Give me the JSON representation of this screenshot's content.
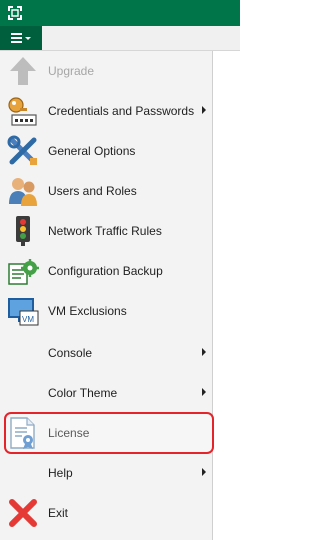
{
  "colors": {
    "titlebar": "#00754a",
    "menu_button": "#005f3d",
    "highlight": "#e4242a"
  },
  "menu": {
    "button_icon": "hamburger-menu-icon",
    "items": [
      {
        "label": "Upgrade",
        "icon": "upgrade-arrow-icon",
        "disabled": true,
        "submenu": false
      },
      {
        "label": "Credentials and Passwords",
        "icon": "key-icon",
        "disabled": false,
        "submenu": true
      },
      {
        "label": "General Options",
        "icon": "tools-icon",
        "disabled": false,
        "submenu": false
      },
      {
        "label": "Users and Roles",
        "icon": "users-icon",
        "disabled": false,
        "submenu": false
      },
      {
        "label": "Network Traffic Rules",
        "icon": "traffic-light-icon",
        "disabled": false,
        "submenu": false
      },
      {
        "label": "Configuration Backup",
        "icon": "config-backup-icon",
        "disabled": false,
        "submenu": false
      },
      {
        "label": "VM Exclusions",
        "icon": "vm-icon",
        "disabled": false,
        "submenu": false
      },
      {
        "label": "Console",
        "icon": "",
        "disabled": false,
        "submenu": true
      },
      {
        "label": "Color Theme",
        "icon": "",
        "disabled": false,
        "submenu": true
      },
      {
        "label": "License",
        "icon": "license-document-icon",
        "disabled": false,
        "submenu": false,
        "highlighted": true
      },
      {
        "label": "Help",
        "icon": "",
        "disabled": false,
        "submenu": true
      },
      {
        "label": "Exit",
        "icon": "exit-x-icon",
        "disabled": false,
        "submenu": false
      }
    ]
  }
}
